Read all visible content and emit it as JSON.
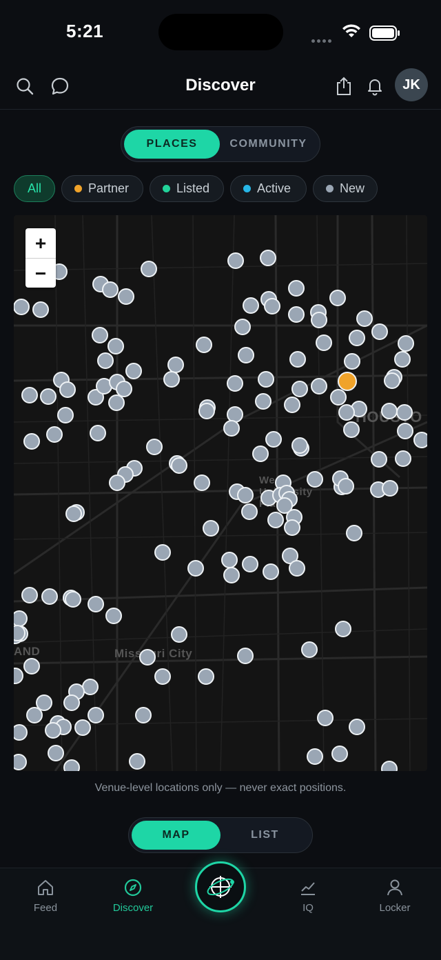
{
  "status_bar": {
    "time": "5:21"
  },
  "header": {
    "title": "Discover",
    "avatar_initials": "JK"
  },
  "top_toggle": {
    "options": [
      "PLACES",
      "COMMUNITY"
    ],
    "selected": "PLACES"
  },
  "filters": [
    {
      "label": "All",
      "active": true,
      "dot_color": null
    },
    {
      "label": "Partner",
      "active": false,
      "dot_color": "#f0a32a"
    },
    {
      "label": "Listed",
      "active": false,
      "dot_color": "#22d39a"
    },
    {
      "label": "Active",
      "active": false,
      "dot_color": "#27b6e6"
    },
    {
      "label": "New",
      "active": false,
      "dot_color": "#9aa6b4"
    }
  ],
  "map": {
    "labels": [
      "HOUSTO",
      "West University Place",
      "Missouri City",
      "AND"
    ],
    "zoom_in": "+",
    "zoom_out": "−"
  },
  "disclaimer": "Venue-level locations only — never exact positions.",
  "view_toggle": {
    "options": [
      "MAP",
      "LIST"
    ],
    "selected": "MAP"
  },
  "bottom_nav": [
    {
      "label": "Feed",
      "icon": "home-icon",
      "active": false
    },
    {
      "label": "Discover",
      "icon": "compass-icon",
      "active": true
    },
    {
      "label": "",
      "icon": "orbit-icon",
      "active": false
    },
    {
      "label": "IQ",
      "icon": "chart-icon",
      "active": false
    },
    {
      "label": "Locker",
      "icon": "user-icon",
      "active": false
    }
  ],
  "colors": {
    "accent": "#1ed6a6",
    "partner": "#f0a32a",
    "pin": "#9aa6b4",
    "background": "#0c0e12"
  }
}
